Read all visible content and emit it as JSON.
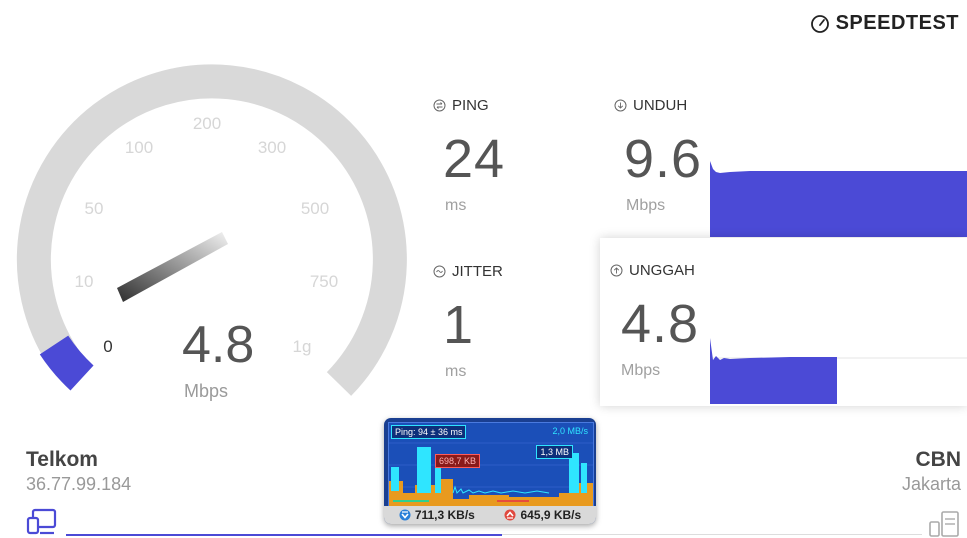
{
  "brand": {
    "label": "SPEEDTEST",
    "icon": "gauge-icon"
  },
  "gauge": {
    "ticks": {
      "t0": "0",
      "t10": "10",
      "t50": "50",
      "t100": "100",
      "t200": "200",
      "t300": "300",
      "t500": "500",
      "t750": "750",
      "t1g": "1g"
    },
    "value": "4.8",
    "unit": "Mbps",
    "fill_color": "#4b4ad6",
    "track_color": "#d9d9d9"
  },
  "stats": {
    "ping": {
      "label": "PING",
      "value": "24",
      "unit": "ms",
      "icon": "ping-icon"
    },
    "jitter": {
      "label": "JITTER",
      "value": "1",
      "unit": "ms",
      "icon": "jitter-icon"
    },
    "download": {
      "label": "UNDUH",
      "value": "9.6",
      "unit": "Mbps",
      "icon": "download-icon"
    },
    "upload": {
      "label": "UNGGAH",
      "value": "4.8",
      "unit": "Mbps",
      "icon": "upload-icon"
    },
    "graph_color": "#4b4ad6",
    "upload_progress": 0.55
  },
  "isp": {
    "name": "Telkom",
    "ip": "36.77.99.184",
    "icon": "computer-icon"
  },
  "server": {
    "name": "CBN",
    "location": "Jakarta",
    "icon": "server-icon"
  },
  "test_progress": 0.5,
  "widget": {
    "ping_text": "Ping: 94 ± 36 ms",
    "top_right": "2,0 MB/s",
    "mid_right": "1,3 MB",
    "mid_left": "698,7 KB",
    "download_rate": "711,3 KB/s",
    "upload_rate": "645,9 KB/s"
  }
}
